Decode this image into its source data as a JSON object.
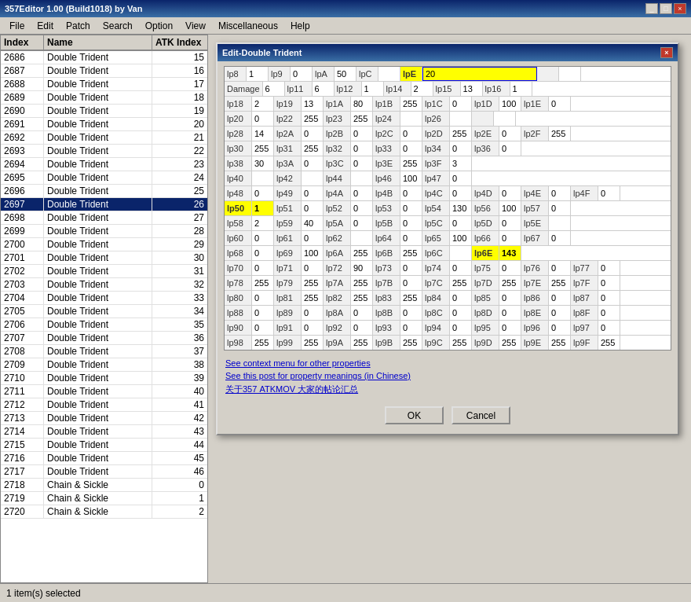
{
  "app": {
    "title": "357Editor 1.00 (Build1018) by Van",
    "title_btns": [
      "_",
      "□",
      "×"
    ]
  },
  "menu": {
    "items": [
      "File",
      "Edit",
      "Patch",
      "Search",
      "Option",
      "View",
      "Miscellaneous",
      "Help"
    ]
  },
  "table": {
    "headers": [
      "Index",
      "Name",
      "ATK Index"
    ],
    "rows": [
      {
        "index": "2686",
        "name": "Double Trident",
        "atk": "15"
      },
      {
        "index": "2687",
        "name": "Double Trident",
        "atk": "16"
      },
      {
        "index": "2688",
        "name": "Double Trident",
        "atk": "17"
      },
      {
        "index": "2689",
        "name": "Double Trident",
        "atk": "18"
      },
      {
        "index": "2690",
        "name": "Double Trident",
        "atk": "19"
      },
      {
        "index": "2691",
        "name": "Double Trident",
        "atk": "20"
      },
      {
        "index": "2692",
        "name": "Double Trident",
        "atk": "21"
      },
      {
        "index": "2693",
        "name": "Double Trident",
        "atk": "22"
      },
      {
        "index": "2694",
        "name": "Double Trident",
        "atk": "23"
      },
      {
        "index": "2695",
        "name": "Double Trident",
        "atk": "24"
      },
      {
        "index": "2696",
        "name": "Double Trident",
        "atk": "25"
      },
      {
        "index": "2697",
        "name": "Double Trident",
        "atk": "26",
        "selected": true
      },
      {
        "index": "2698",
        "name": "Double Trident",
        "atk": "27"
      },
      {
        "index": "2699",
        "name": "Double Trident",
        "atk": "28"
      },
      {
        "index": "2700",
        "name": "Double Trident",
        "atk": "29"
      },
      {
        "index": "2701",
        "name": "Double Trident",
        "atk": "30"
      },
      {
        "index": "2702",
        "name": "Double Trident",
        "atk": "31"
      },
      {
        "index": "2703",
        "name": "Double Trident",
        "atk": "32"
      },
      {
        "index": "2704",
        "name": "Double Trident",
        "atk": "33"
      },
      {
        "index": "2705",
        "name": "Double Trident",
        "atk": "34"
      },
      {
        "index": "2706",
        "name": "Double Trident",
        "atk": "35"
      },
      {
        "index": "2707",
        "name": "Double Trident",
        "atk": "36"
      },
      {
        "index": "2708",
        "name": "Double Trident",
        "atk": "37"
      },
      {
        "index": "2709",
        "name": "Double Trident",
        "atk": "38"
      },
      {
        "index": "2710",
        "name": "Double Trident",
        "atk": "39"
      },
      {
        "index": "2711",
        "name": "Double Trident",
        "atk": "40"
      },
      {
        "index": "2712",
        "name": "Double Trident",
        "atk": "41"
      },
      {
        "index": "2713",
        "name": "Double Trident",
        "atk": "42"
      },
      {
        "index": "2714",
        "name": "Double Trident",
        "atk": "43"
      },
      {
        "index": "2715",
        "name": "Double Trident",
        "atk": "44"
      },
      {
        "index": "2716",
        "name": "Double Trident",
        "atk": "45"
      },
      {
        "index": "2717",
        "name": "Double Trident",
        "atk": "46"
      },
      {
        "index": "2718",
        "name": "Chain & Sickle",
        "atk": "0"
      },
      {
        "index": "2719",
        "name": "Chain & Sickle",
        "atk": "1"
      },
      {
        "index": "2720",
        "name": "Chain & Sickle",
        "atk": "2"
      }
    ]
  },
  "dialog": {
    "title": "Edit-Double Trident",
    "properties": [
      [
        {
          "label": "lp8",
          "value": "1"
        },
        {
          "label": "lp9",
          "value": "0"
        },
        {
          "label": "lpA",
          "value": "50"
        },
        {
          "label": "lpC",
          "value": ""
        },
        {
          "label": "lpE",
          "value": "20",
          "highlight_label": true,
          "highlight_value": true,
          "editing": true
        },
        {
          "label": "",
          "value": ""
        }
      ],
      [
        {
          "label": "Damage",
          "value": "6"
        },
        {
          "label": "lp11",
          "value": "6"
        },
        {
          "label": "lp12",
          "value": "1"
        },
        {
          "label": "lp14",
          "value": "2"
        },
        {
          "label": "lp15",
          "value": "13"
        },
        {
          "label": "lp16",
          "value": "1"
        }
      ],
      [
        {
          "label": "lp18",
          "value": "2"
        },
        {
          "label": "lp19",
          "value": "13"
        },
        {
          "label": "lp1A",
          "value": "80"
        },
        {
          "label": "lp1B",
          "value": "255"
        },
        {
          "label": "lp1C",
          "value": "0"
        },
        {
          "label": "lp1D",
          "value": "100"
        },
        {
          "label": "lp1E",
          "value": "0"
        }
      ],
      [
        {
          "label": "lp20",
          "value": "0"
        },
        {
          "label": "lp22",
          "value": "255"
        },
        {
          "label": "lp23",
          "value": "255"
        },
        {
          "label": "lp24",
          "value": ""
        },
        {
          "label": "lp26",
          "value": ""
        },
        {
          "label": "",
          "value": ""
        }
      ],
      [
        {
          "label": "lp28",
          "value": "14"
        },
        {
          "label": "lp2A",
          "value": "0"
        },
        {
          "label": "lp2B",
          "value": "0"
        },
        {
          "label": "lp2C",
          "value": "0"
        },
        {
          "label": "lp2D",
          "value": "255"
        },
        {
          "label": "lp2E",
          "value": "0"
        },
        {
          "label": "lp2F",
          "value": "255"
        }
      ],
      [
        {
          "label": "lp30",
          "value": "255"
        },
        {
          "label": "lp31",
          "value": "255"
        },
        {
          "label": "lp32",
          "value": "0"
        },
        {
          "label": "lp33",
          "value": "0"
        },
        {
          "label": "lp34",
          "value": "0"
        },
        {
          "label": "lp36",
          "value": "0"
        }
      ],
      [
        {
          "label": "lp38",
          "value": "30"
        },
        {
          "label": "lp3A",
          "value": "0"
        },
        {
          "label": "lp3C",
          "value": "0"
        },
        {
          "label": "lp3E",
          "value": "255"
        },
        {
          "label": "lp3F",
          "value": "3"
        }
      ],
      [
        {
          "label": "lp40",
          "value": ""
        },
        {
          "label": "lp42",
          "value": ""
        },
        {
          "label": "lp44",
          "value": ""
        },
        {
          "label": "lp46",
          "value": "100"
        },
        {
          "label": "lp47",
          "value": "0"
        }
      ],
      [
        {
          "label": "lp48",
          "value": "0"
        },
        {
          "label": "lp49",
          "value": "0"
        },
        {
          "label": "lp4A",
          "value": "0"
        },
        {
          "label": "lp4B",
          "value": "0"
        },
        {
          "label": "lp4C",
          "value": "0"
        },
        {
          "label": "lp4D",
          "value": "0"
        },
        {
          "label": "lp4E",
          "value": "0"
        },
        {
          "label": "lp4F",
          "value": "0"
        }
      ],
      [
        {
          "label": "lp50",
          "value": "1",
          "highlight_label": true,
          "highlight_value": true
        },
        {
          "label": "lp51",
          "value": "0"
        },
        {
          "label": "lp52",
          "value": "0"
        },
        {
          "label": "lp53",
          "value": "0"
        },
        {
          "label": "lp54",
          "value": "130"
        },
        {
          "label": "lp56",
          "value": "100"
        },
        {
          "label": "lp57",
          "value": "0"
        }
      ],
      [
        {
          "label": "lp58",
          "value": "2"
        },
        {
          "label": "lp59",
          "value": "40"
        },
        {
          "label": "lp5A",
          "value": "0"
        },
        {
          "label": "lp5B",
          "value": "0"
        },
        {
          "label": "lp5C",
          "value": "0"
        },
        {
          "label": "lp5D",
          "value": "0"
        },
        {
          "label": "lp5E",
          "value": ""
        }
      ],
      [
        {
          "label": "lp60",
          "value": "0"
        },
        {
          "label": "lp61",
          "value": "0"
        },
        {
          "label": "lp62",
          "value": ""
        },
        {
          "label": "lp64",
          "value": "0"
        },
        {
          "label": "lp65",
          "value": "100"
        },
        {
          "label": "lp66",
          "value": "0"
        },
        {
          "label": "lp67",
          "value": "0"
        }
      ],
      [
        {
          "label": "lp68",
          "value": "0"
        },
        {
          "label": "lp69",
          "value": "100"
        },
        {
          "label": "lp6A",
          "value": "255"
        },
        {
          "label": "lp6B",
          "value": "255"
        },
        {
          "label": "lp6C",
          "value": ""
        },
        {
          "label": "lp6E",
          "value": "143",
          "highlight_label": true,
          "highlight_value": true
        }
      ],
      [
        {
          "label": "lp70",
          "value": "0"
        },
        {
          "label": "lp71",
          "value": "0"
        },
        {
          "label": "lp72",
          "value": "90"
        },
        {
          "label": "lp73",
          "value": "0"
        },
        {
          "label": "lp74",
          "value": "0"
        },
        {
          "label": "lp75",
          "value": "0"
        },
        {
          "label": "lp76",
          "value": "0"
        },
        {
          "label": "lp77",
          "value": "0"
        }
      ],
      [
        {
          "label": "lp78",
          "value": "255"
        },
        {
          "label": "lp79",
          "value": "255"
        },
        {
          "label": "lp7A",
          "value": "255"
        },
        {
          "label": "lp7B",
          "value": "0"
        },
        {
          "label": "lp7C",
          "value": "255"
        },
        {
          "label": "lp7D",
          "value": "255"
        },
        {
          "label": "lp7E",
          "value": "255"
        },
        {
          "label": "lp7F",
          "value": "0"
        }
      ],
      [
        {
          "label": "lp80",
          "value": "0"
        },
        {
          "label": "lp81",
          "value": "255"
        },
        {
          "label": "lp82",
          "value": "255"
        },
        {
          "label": "lp83",
          "value": "255"
        },
        {
          "label": "lp84",
          "value": "0"
        },
        {
          "label": "lp85",
          "value": "0"
        },
        {
          "label": "lp86",
          "value": "0"
        },
        {
          "label": "lp87",
          "value": "0"
        }
      ],
      [
        {
          "label": "lp88",
          "value": "0"
        },
        {
          "label": "lp89",
          "value": "0"
        },
        {
          "label": "lp8A",
          "value": "0"
        },
        {
          "label": "lp8B",
          "value": "0"
        },
        {
          "label": "lp8C",
          "value": "0"
        },
        {
          "label": "lp8D",
          "value": "0"
        },
        {
          "label": "lp8E",
          "value": "0"
        },
        {
          "label": "lp8F",
          "value": "0"
        }
      ],
      [
        {
          "label": "lp90",
          "value": "0"
        },
        {
          "label": "lp91",
          "value": "0"
        },
        {
          "label": "lp92",
          "value": "0"
        },
        {
          "label": "lp93",
          "value": "0"
        },
        {
          "label": "lp94",
          "value": "0"
        },
        {
          "label": "lp95",
          "value": "0"
        },
        {
          "label": "lp96",
          "value": "0"
        },
        {
          "label": "lp97",
          "value": "0"
        }
      ],
      [
        {
          "label": "lp98",
          "value": "255"
        },
        {
          "label": "lp99",
          "value": "255"
        },
        {
          "label": "lp9A",
          "value": "255"
        },
        {
          "label": "lp9B",
          "value": "255"
        },
        {
          "label": "lp9C",
          "value": "255"
        },
        {
          "label": "lp9D",
          "value": "255"
        },
        {
          "label": "lp9E",
          "value": "255"
        },
        {
          "label": "lp9F",
          "value": "255"
        }
      ]
    ],
    "links": [
      {
        "text": "See context menu for other properties",
        "color": "#0000cc"
      },
      {
        "text": "See this post for property meanings (in Chinese)",
        "color": "#0000cc"
      },
      {
        "text": "关于357 ATKMOV 大家的帖论汇总",
        "color": "#0000cc"
      }
    ],
    "buttons": [
      "OK",
      "Cancel"
    ]
  },
  "status": {
    "text": "1 item(s) selected"
  }
}
